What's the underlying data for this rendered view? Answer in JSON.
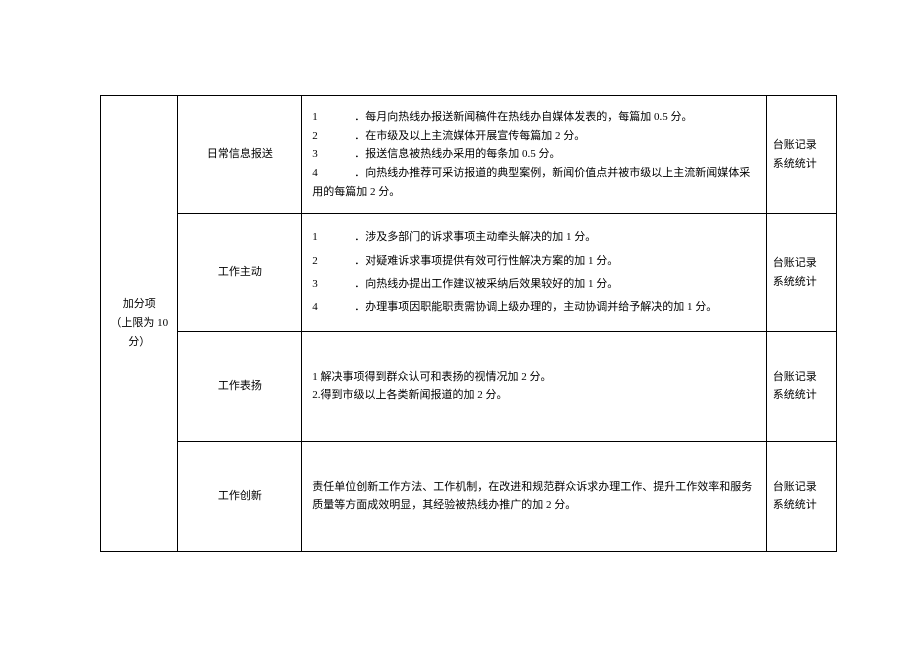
{
  "category": {
    "title_line1": "加分项",
    "title_line2": "（上限为 10",
    "title_line3": "分）"
  },
  "rows": [
    {
      "item": "日常信息报送",
      "desc_lines": [
        {
          "num": "1",
          "text": "．每月向热线办报送新闻稿件在热线办自媒体发表的，每篇加 0.5 分。"
        },
        {
          "num": "2",
          "text": "．在市级及以上主流媒体开展宣传每篇加 2 分。"
        },
        {
          "num": "3",
          "text": "．报送信息被热线办采用的每条加 0.5 分。"
        },
        {
          "num": "4",
          "text": "．向热线办推荐可采访报道的典型案例，新闻价值点并被市级以上主流新闻媒体采用的每篇加 2 分。",
          "wrap": true
        }
      ],
      "method_line1": "台账记录",
      "method_line2": "系统统计"
    },
    {
      "item": "工作主动",
      "desc_lines": [
        {
          "num": "1",
          "text": "．涉及多部门的诉求事项主动牵头解决的加 1 分。"
        },
        {
          "num": "2",
          "text": "．对疑难诉求事项提供有效可行性解决方案的加 1 分。"
        },
        {
          "num": "3",
          "text": "．向热线办提出工作建议被采纳后效果较好的加 1 分。"
        },
        {
          "num": "4",
          "text": "．办理事项因职能职责需协调上级办理的，主动协调并给予解决的加 1 分。",
          "wrap": true
        }
      ],
      "method_line1": "台账记录",
      "method_line2": "系统统计"
    },
    {
      "item": "工作表扬",
      "desc_lines_plain": [
        "1 解决事项得到群众认可和表扬的视情况加 2 分。",
        "2.得到市级以上各类新闻报道的加 2 分。"
      ],
      "method_line1": "台账记录",
      "method_line2": "系统统计"
    },
    {
      "item": "工作创新",
      "desc_plain": "责任单位创新工作方法、工作机制，在改进和规范群众诉求办理工作、提升工作效率和服务质量等方面成效明显，其经验被热线办推广的加 2 分。",
      "method_line1": "台账记录",
      "method_line2": "系统统计"
    }
  ]
}
